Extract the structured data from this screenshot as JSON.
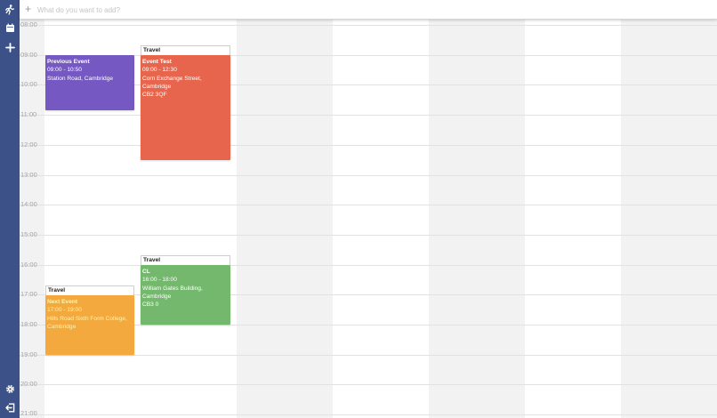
{
  "search": {
    "placeholder": "What do you want to add?",
    "add_icon": "plus-icon"
  },
  "sidebar": {
    "top_icons": [
      "running-person-icon",
      "calendar-icon",
      "plus-icon"
    ],
    "bottom_icons": [
      "gear-icon",
      "logout-icon"
    ]
  },
  "hours": [
    "08:00",
    "09:00",
    "10:00",
    "11:00",
    "12:00",
    "13:00",
    "14:00",
    "15:00",
    "16:00",
    "17:00",
    "18:00",
    "19:00",
    "20:00",
    "21:00"
  ],
  "events": [
    {
      "title": "Previous Event",
      "time": "09:00 - 10:50",
      "location": [
        "Station Road, Cambridge"
      ],
      "color": "#7558c1",
      "title_color": "#ffffff"
    },
    {
      "travel": "Travel",
      "title": "Event Test",
      "time": "09:00 - 12:30",
      "location": [
        "Corn Exchange Street, Cambridge",
        "CB2 3QF"
      ],
      "color": "#e8654d",
      "title_color": "#ffffff"
    },
    {
      "travel": "Travel",
      "title": "CL",
      "time": "16:00 - 18:00",
      "location": [
        "William Gates Building, Cambridge",
        "CB3 0"
      ],
      "color": "#74b86d",
      "title_color": "#ffffff"
    },
    {
      "travel": "Travel",
      "title": "Next Event",
      "time": "17:00 - 19:00",
      "location": [
        "Hills Road Sixth Form College,",
        "Cambridge"
      ],
      "color": "#f4a93f",
      "title_color": "#fff3a8"
    }
  ],
  "colors": {
    "sidebar": "#3b5188",
    "grid_line": "#e2e2e2",
    "column_alt": "#f2f2f2"
  }
}
